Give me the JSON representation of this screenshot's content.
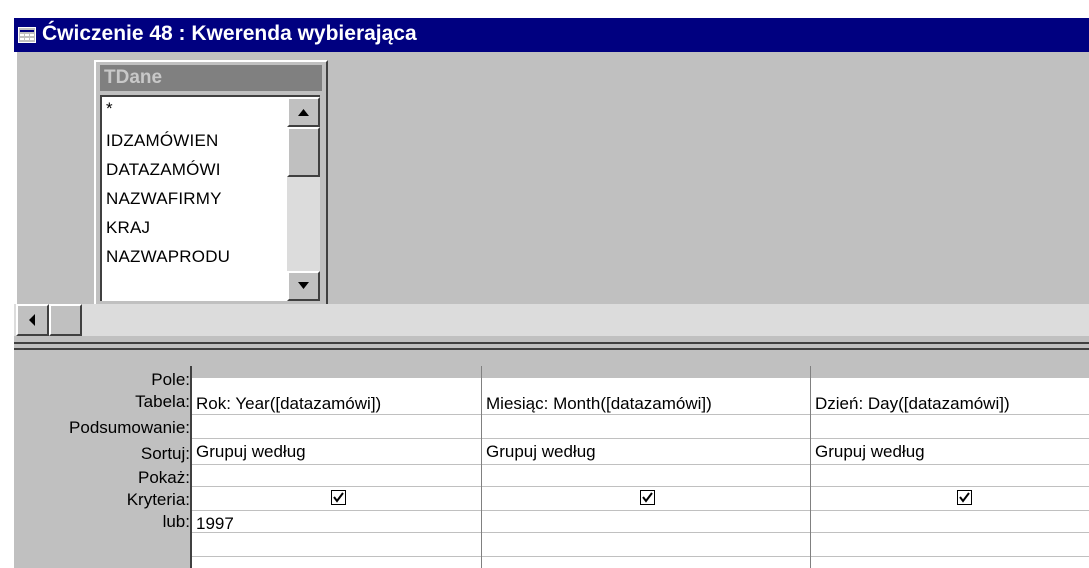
{
  "window": {
    "title": "Ćwiczenie 48 : Kwerenda wybierająca",
    "icon": "query-window-icon",
    "title_bar_color": "#000080"
  },
  "table": {
    "name": "TDane",
    "fields": [
      "*",
      "IDZAMÓWIEN",
      "DATAZAMÓWI",
      "NAZWAFIRMY",
      "KRAJ",
      "NAZWAPRODU"
    ]
  },
  "grid": {
    "row_labels": [
      "Pole:",
      "Tabela:",
      "Podsumowanie:",
      "Sortuj:",
      "Pokaż:",
      "Kryteria:",
      "lub:"
    ],
    "columns": [
      {
        "pole": "Rok: Year([datazamówi])",
        "tabela": "",
        "podsumowanie": "Grupuj według",
        "sortuj": "",
        "pokaz": true,
        "kryteria": "1997",
        "lub": ""
      },
      {
        "pole": "Miesiąc: Month([datazamówi])",
        "tabela": "",
        "podsumowanie": "Grupuj według",
        "sortuj": "",
        "pokaz": true,
        "kryteria": "",
        "lub": ""
      },
      {
        "pole": "Dzień: Day([datazamówi])",
        "tabela": "",
        "podsumowanie": "Grupuj według",
        "sortuj": "",
        "pokaz": true,
        "kryteria": "",
        "lub": ""
      }
    ]
  }
}
